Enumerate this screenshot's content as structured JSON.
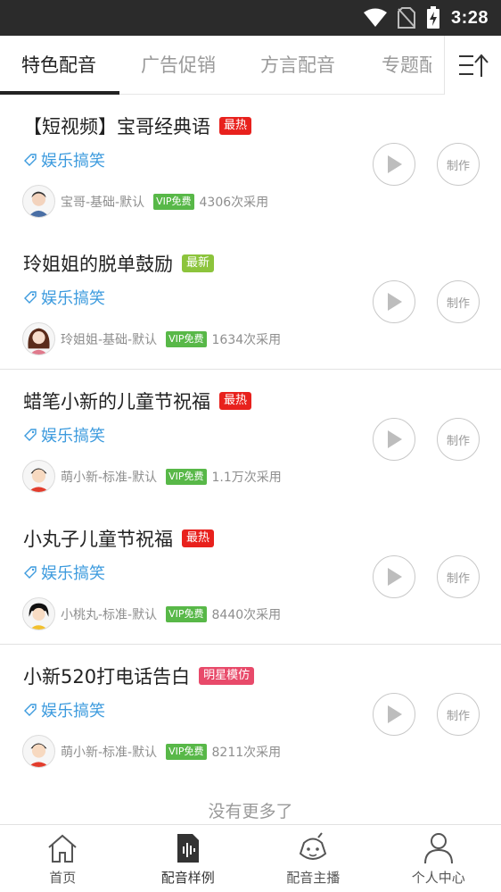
{
  "status_bar": {
    "time": "3:28"
  },
  "tabs": [
    {
      "label": "特色配音",
      "active": true
    },
    {
      "label": "广告促销",
      "active": false
    },
    {
      "label": "方言配音",
      "active": false
    },
    {
      "label": "专题配音",
      "active": false
    }
  ],
  "items": [
    {
      "title": "【短视频】宝哥经典语",
      "badge": "最热",
      "badge_color": "#e8211d",
      "category": "娱乐搞笑",
      "voice": "宝哥-基础-默认",
      "vip": "VIP免费",
      "uses": "4306次采用",
      "play_label": "play-icon",
      "make_label": "制作"
    },
    {
      "title": "玲姐姐的脱单鼓励",
      "badge": "最新",
      "badge_color": "#8cc43c",
      "category": "娱乐搞笑",
      "voice": "玲姐姐-基础-默认",
      "vip": "VIP免费",
      "uses": "1634次采用",
      "play_label": "play-icon",
      "make_label": "制作"
    },
    {
      "title": "蜡笔小新的儿童节祝福",
      "badge": "最热",
      "badge_color": "#e8211d",
      "category": "娱乐搞笑",
      "voice": "萌小新-标准-默认",
      "vip": "VIP免费",
      "uses": "1.1万次采用",
      "play_label": "play-icon",
      "make_label": "制作"
    },
    {
      "title": "小丸子儿童节祝福",
      "badge": "最热",
      "badge_color": "#e8211d",
      "category": "娱乐搞笑",
      "voice": "小桃丸-标准-默认",
      "vip": "VIP免费",
      "uses": "8440次采用",
      "play_label": "play-icon",
      "make_label": "制作"
    },
    {
      "title": "小新520打电话告白",
      "badge": "明星模仿",
      "badge_color": "#e84a6a",
      "category": "娱乐搞笑",
      "voice": "萌小新-标准-默认",
      "vip": "VIP免费",
      "uses": "8211次采用",
      "play_label": "play-icon",
      "make_label": "制作"
    }
  ],
  "footer_text": "没有更多了",
  "bottom_nav": [
    {
      "label": "首页",
      "icon": "home-icon",
      "active": false
    },
    {
      "label": "配音样例",
      "icon": "voice-sample-icon",
      "active": true
    },
    {
      "label": "配音主播",
      "icon": "anchor-icon",
      "active": false
    },
    {
      "label": "个人中心",
      "icon": "profile-icon",
      "active": false
    }
  ]
}
